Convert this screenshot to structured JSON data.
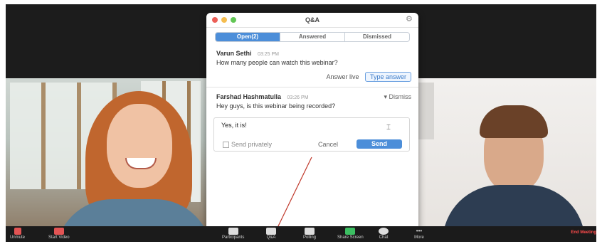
{
  "qa_window": {
    "title": "Q&A",
    "tabs": [
      {
        "label": "Open(2)",
        "active": true
      },
      {
        "label": "Answered",
        "active": false
      },
      {
        "label": "Dismissed",
        "active": false
      }
    ],
    "questions": [
      {
        "asker": "Varun Sethi",
        "time": "03:25 PM",
        "text": "How many people can watch this webinar?",
        "answer_live_label": "Answer live",
        "type_answer_label": "Type answer"
      },
      {
        "asker": "Farshad Hashmatulla",
        "time": "03:26 PM",
        "text": "Hey guys, is this webinar being recorded?",
        "dismiss_label": "▾ Dismiss",
        "answer_text": "Yes, it is!",
        "send_privately_label": "Send privately",
        "cancel_label": "Cancel",
        "send_label": "Send"
      }
    ]
  },
  "toolbar": {
    "items": [
      {
        "label": "Unmute",
        "icon": "microphone-muted-icon"
      },
      {
        "label": "Start Video",
        "icon": "video-off-icon"
      },
      {
        "label": "Participants",
        "icon": "participants-icon"
      },
      {
        "label": "Q&A",
        "icon": "qa-icon"
      },
      {
        "label": "Polling",
        "icon": "polling-icon"
      },
      {
        "label": "Share Screen",
        "icon": "share-screen-icon"
      },
      {
        "label": "Chat",
        "icon": "chat-icon"
      },
      {
        "label": "More",
        "icon": "more-icon"
      }
    ],
    "end_label": "End Meeting"
  },
  "colors": {
    "accent": "#4c8ed9",
    "end": "#ff4b4b"
  }
}
